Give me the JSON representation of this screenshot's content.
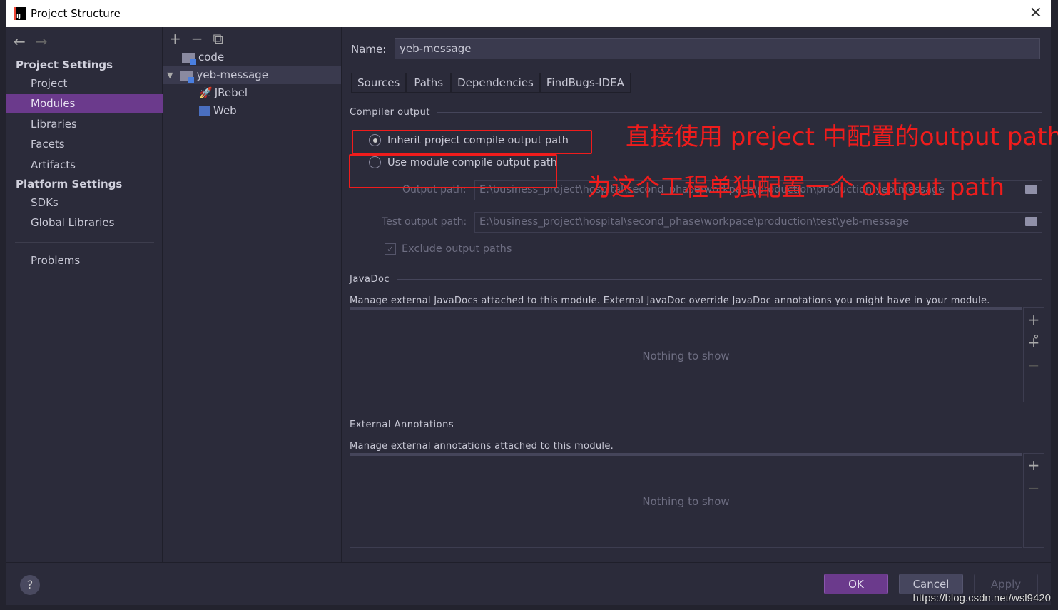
{
  "window": {
    "title": "Project Structure",
    "logo": "IJ"
  },
  "sidebar": {
    "project_settings": "Project Settings",
    "platform_settings": "Platform Settings",
    "items": [
      {
        "label": "Project"
      },
      {
        "label": "Modules"
      },
      {
        "label": "Libraries"
      },
      {
        "label": "Facets"
      },
      {
        "label": "Artifacts"
      },
      {
        "label": "SDKs"
      },
      {
        "label": "Global Libraries"
      },
      {
        "label": "Problems"
      }
    ]
  },
  "tree": {
    "nodes": [
      {
        "label": "code"
      },
      {
        "label": "yeb-message"
      },
      {
        "label": "JRebel"
      },
      {
        "label": "Web"
      }
    ]
  },
  "main": {
    "name_label": "Name:",
    "name_value": "yeb-message",
    "tabs": [
      {
        "label": "Sources"
      },
      {
        "label": "Paths"
      },
      {
        "label": "Dependencies"
      },
      {
        "label": "FindBugs-IDEA"
      }
    ],
    "compiler_output": "Compiler output",
    "inherit": "Inherit project compile output path",
    "use_module": "Use module compile output path",
    "output_label": "Output path:",
    "output_value": "E:\\business_project\\hospital\\second_phase\\workpace\\production\\production\\yeb-message",
    "test_label": "Test output path:",
    "test_value": "E:\\business_project\\hospital\\second_phase\\workpace\\production\\test\\yeb-message",
    "exclude": "Exclude output paths",
    "javadoc": "JavaDoc",
    "javadoc_desc": "Manage external JavaDocs attached to this module. External JavaDoc override JavaDoc annotations you might have in your module.",
    "nothing": "Nothing to show",
    "ext_ann": "External Annotations",
    "ext_desc": "Manage external annotations attached to this module."
  },
  "annotations": {
    "a1": "直接使用 preject 中配置的output path",
    "a2": "为这个工程单独配置一个 output path"
  },
  "buttons": {
    "ok": "OK",
    "cancel": "Cancel",
    "apply": "Apply",
    "help": "?"
  },
  "watermark": "https://blog.csdn.net/wsl9420"
}
